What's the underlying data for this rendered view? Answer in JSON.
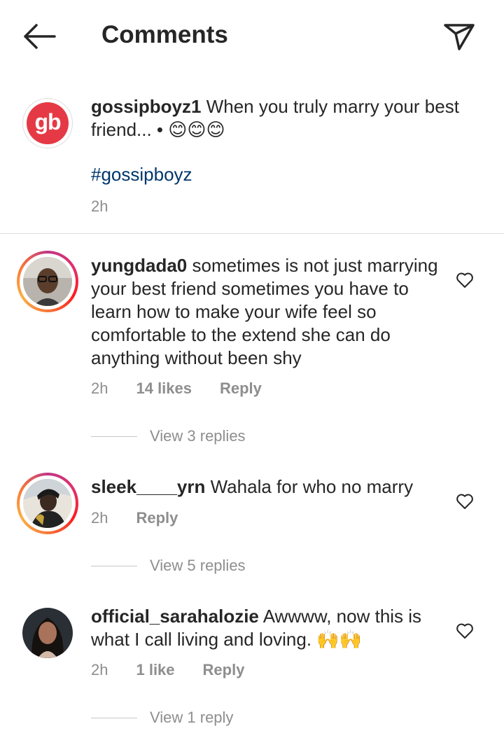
{
  "header": {
    "title": "Comments",
    "back_icon": "arrow-left-icon",
    "share_icon": "paper-plane-icon"
  },
  "caption": {
    "avatar_text": "gb",
    "username": "gossipboyz1",
    "text": "When you truly marry your best friend... • ",
    "emojis": "😊😊😊",
    "hashtag": "#gossipboyz",
    "time": "2h"
  },
  "comments": [
    {
      "username": "yungdada0",
      "text": "sometimes is not just marrying your best friend sometimes you have to learn how to make your wife feel so comfortable to the extend she can do anything without been shy",
      "time": "2h",
      "likes": "14 likes",
      "reply": "Reply",
      "view_replies": "View 3 replies"
    },
    {
      "username": "sleek____yrn",
      "text": "Wahala for who no marry",
      "time": "2h",
      "reply": "Reply",
      "view_replies": "View 5 replies"
    },
    {
      "username": "official_sarahalozie",
      "text": "Awwww, now this is what I call living and loving. ",
      "emojis": "🙌🙌",
      "time": "2h",
      "likes": "1 like",
      "reply": "Reply",
      "view_replies": "View 1 reply"
    }
  ],
  "colors": {
    "text": "#262626",
    "secondary": "#8e8e8e",
    "hashtag": "#00376b",
    "brand_red": "#e53a45",
    "divider": "#dbdbdb"
  }
}
